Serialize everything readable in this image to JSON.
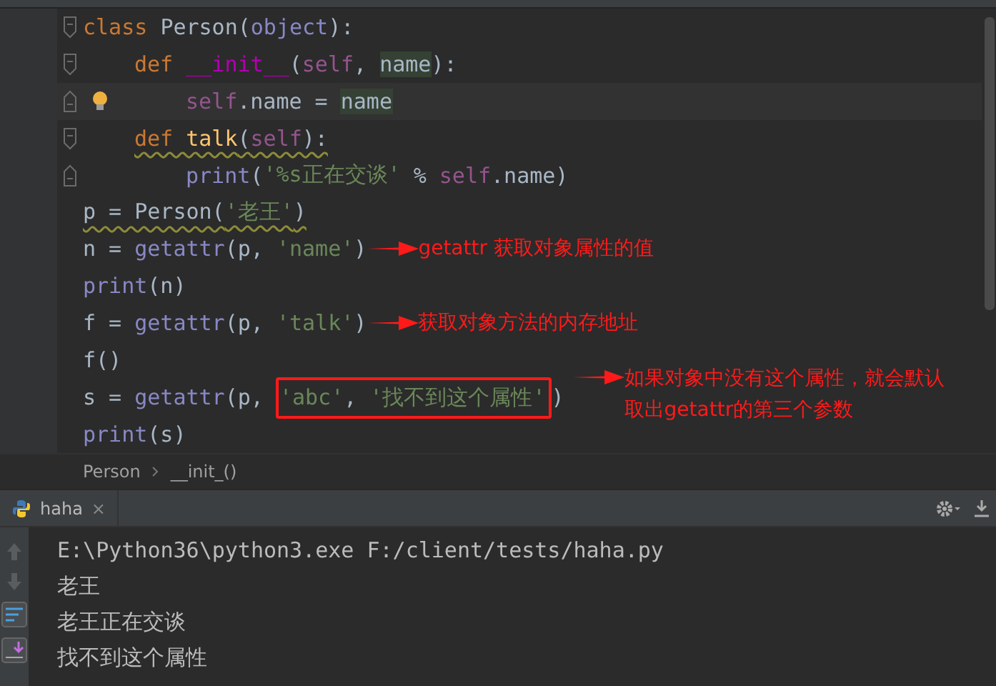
{
  "editor": {
    "lines": [
      {
        "tokens": [
          {
            "kind": "keyword",
            "text": "class "
          },
          {
            "kind": "plain",
            "text": "Person"
          },
          {
            "kind": "plain",
            "text": "("
          },
          {
            "kind": "builtin",
            "text": "object"
          },
          {
            "kind": "plain",
            "text": "):"
          }
        ],
        "children": [
          {
            "tokens": [
              {
                "kind": "keyword",
                "text": "def "
              },
              {
                "kind": "magic",
                "text": "__init__"
              },
              {
                "kind": "plain",
                "text": "("
              },
              {
                "kind": "self",
                "text": "self"
              },
              {
                "kind": "plain",
                "text": ", "
              },
              {
                "kind": "param",
                "text": "name"
              },
              {
                "kind": "plain",
                "text": "):"
              }
            ],
            "children": [
              {
                "current": true,
                "bulb": true,
                "tokens": [
                  {
                    "kind": "self",
                    "text": "self"
                  },
                  {
                    "kind": "plain",
                    "text": ".name = "
                  },
                  {
                    "kind": "param",
                    "text": "name"
                  }
                ]
              }
            ]
          },
          {
            "warning": true,
            "tokens": [
              {
                "kind": "keyword",
                "text": "def "
              },
              {
                "kind": "function",
                "text": "talk"
              },
              {
                "kind": "plain",
                "text": "("
              },
              {
                "kind": "self",
                "text": "self"
              },
              {
                "kind": "plain",
                "text": "):"
              }
            ],
            "children": [
              {
                "tokens": [
                  {
                    "kind": "builtin",
                    "text": "print"
                  },
                  {
                    "kind": "plain",
                    "text": "("
                  },
                  {
                    "kind": "string",
                    "text": "'%s正在交谈'"
                  },
                  {
                    "kind": "plain",
                    "text": " % "
                  },
                  {
                    "kind": "self",
                    "text": "self"
                  },
                  {
                    "kind": "plain",
                    "text": ".name)"
                  }
                ]
              }
            ]
          }
        ]
      },
      {
        "warning": true,
        "tokens": [
          {
            "kind": "plain",
            "text": "p = Person("
          },
          {
            "kind": "string",
            "text": "'老王'"
          },
          {
            "kind": "plain",
            "text": ")"
          }
        ]
      },
      {
        "tokens": [
          {
            "kind": "plain",
            "text": "n = "
          },
          {
            "kind": "builtin",
            "text": "getattr"
          },
          {
            "kind": "plain",
            "text": "(p, "
          },
          {
            "kind": "string",
            "text": "'name'"
          },
          {
            "kind": "plain",
            "text": ")"
          }
        ],
        "note": "getattr 获取对象属性的值"
      },
      {
        "tokens": [
          {
            "kind": "builtin",
            "text": "print"
          },
          {
            "kind": "plain",
            "text": "(n)"
          }
        ]
      },
      {
        "tokens": [
          {
            "kind": "plain",
            "text": "f = "
          },
          {
            "kind": "builtin",
            "text": "getattr"
          },
          {
            "kind": "plain",
            "text": "(p, "
          },
          {
            "kind": "string",
            "text": "'talk'"
          },
          {
            "kind": "plain",
            "text": ")"
          }
        ],
        "note": "获取对象方法的内存地址"
      },
      {
        "tokens": [
          {
            "kind": "plain",
            "text": "f()"
          }
        ]
      },
      {
        "tokens": [
          {
            "kind": "plain",
            "text": "s = "
          },
          {
            "kind": "builtin",
            "text": "getattr"
          },
          {
            "kind": "plain",
            "text": "(p, "
          },
          {
            "kind": "box",
            "tokens": [
              {
                "kind": "string",
                "text": "'abc'"
              },
              {
                "kind": "plain",
                "text": ", "
              },
              {
                "kind": "string",
                "text": "'找不到这个属性'"
              }
            ]
          },
          {
            "kind": "plain",
            "text": ")"
          }
        ],
        "note": "如果对象中没有这个属性，就会默认取出getattr的第三个参数"
      },
      {
        "tokens": [
          {
            "kind": "builtin",
            "text": "print"
          },
          {
            "kind": "plain",
            "text": "(s)"
          }
        ]
      }
    ]
  },
  "breadcrumb": [
    "Person",
    "__init_()"
  ],
  "run_panel": {
    "tab": {
      "label": "haha",
      "close": "×"
    },
    "output": [
      "E:\\Python36\\python3.exe F:/client/tests/haha.py",
      "老王",
      "老王正在交谈",
      "找不到这个属性"
    ]
  }
}
